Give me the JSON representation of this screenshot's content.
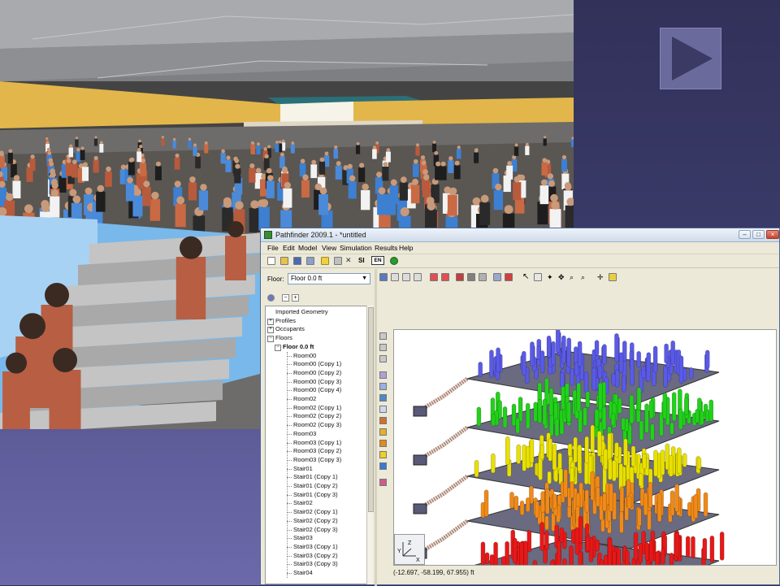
{
  "render": {
    "scene": "crowd-on-stairs-3d-render"
  },
  "play_button": {
    "icon": "play-triangle-icon"
  },
  "app": {
    "title": "Pathfinder 2009.1 - *untitled",
    "window_buttons": [
      "minimize",
      "maximize",
      "close"
    ],
    "menu": [
      "File",
      "Edit",
      "Model",
      "View",
      "Simulation",
      "Results",
      "Help"
    ],
    "toolbar": {
      "si_label": "SI",
      "en_label": "EN"
    },
    "floor_label": "Floor:",
    "floor_selected": "Floor 0.0 ft",
    "tree": [
      {
        "label": "Imported Geometry",
        "level": 0,
        "bold": false
      },
      {
        "label": "Profiles",
        "level": 0,
        "bold": false
      },
      {
        "label": "Occupants",
        "level": 0,
        "bold": false
      },
      {
        "label": "Floors",
        "level": 0,
        "bold": false
      },
      {
        "label": "Floor 0.0 ft",
        "level": 1,
        "bold": true
      },
      {
        "label": "Room00",
        "level": 2,
        "bold": false
      },
      {
        "label": "Room00 (Copy 1)",
        "level": 2,
        "bold": false
      },
      {
        "label": "Room00 (Copy 2)",
        "level": 2,
        "bold": false
      },
      {
        "label": "Room00 (Copy 3)",
        "level": 2,
        "bold": false
      },
      {
        "label": "Room00 (Copy 4)",
        "level": 2,
        "bold": false
      },
      {
        "label": "Room02",
        "level": 2,
        "bold": false
      },
      {
        "label": "Room02 (Copy 1)",
        "level": 2,
        "bold": false
      },
      {
        "label": "Room02 (Copy 2)",
        "level": 2,
        "bold": false
      },
      {
        "label": "Room02 (Copy 3)",
        "level": 2,
        "bold": false
      },
      {
        "label": "Room03",
        "level": 2,
        "bold": false
      },
      {
        "label": "Room03 (Copy 1)",
        "level": 2,
        "bold": false
      },
      {
        "label": "Room03 (Copy 2)",
        "level": 2,
        "bold": false
      },
      {
        "label": "Room03 (Copy 3)",
        "level": 2,
        "bold": false
      },
      {
        "label": "Stair01",
        "level": 2,
        "bold": false
      },
      {
        "label": "Stair01 (Copy 1)",
        "level": 2,
        "bold": false
      },
      {
        "label": "Stair01 (Copy 2)",
        "level": 2,
        "bold": false
      },
      {
        "label": "Stair01 (Copy 3)",
        "level": 2,
        "bold": false
      },
      {
        "label": "Stair02",
        "level": 2,
        "bold": false
      },
      {
        "label": "Stair02 (Copy 1)",
        "level": 2,
        "bold": false
      },
      {
        "label": "Stair02 (Copy 2)",
        "level": 2,
        "bold": false
      },
      {
        "label": "Stair02 (Copy 3)",
        "level": 2,
        "bold": false
      },
      {
        "label": "Stair03",
        "level": 2,
        "bold": false
      },
      {
        "label": "Stair03 (Copy 1)",
        "level": 2,
        "bold": false
      },
      {
        "label": "Stair03 (Copy 2)",
        "level": 2,
        "bold": false
      },
      {
        "label": "Stair03 (Copy 3)",
        "level": 2,
        "bold": false
      },
      {
        "label": "Stair04",
        "level": 2,
        "bold": false
      }
    ],
    "status_coords": "(-12.697, -58.199, 67.955) ft",
    "axis_labels": {
      "x": "X",
      "y": "Y",
      "z": "Z"
    },
    "floor_colors": [
      "#5a5ae8",
      "#22d11a",
      "#e8e000",
      "#f08a18",
      "#e81818"
    ]
  }
}
